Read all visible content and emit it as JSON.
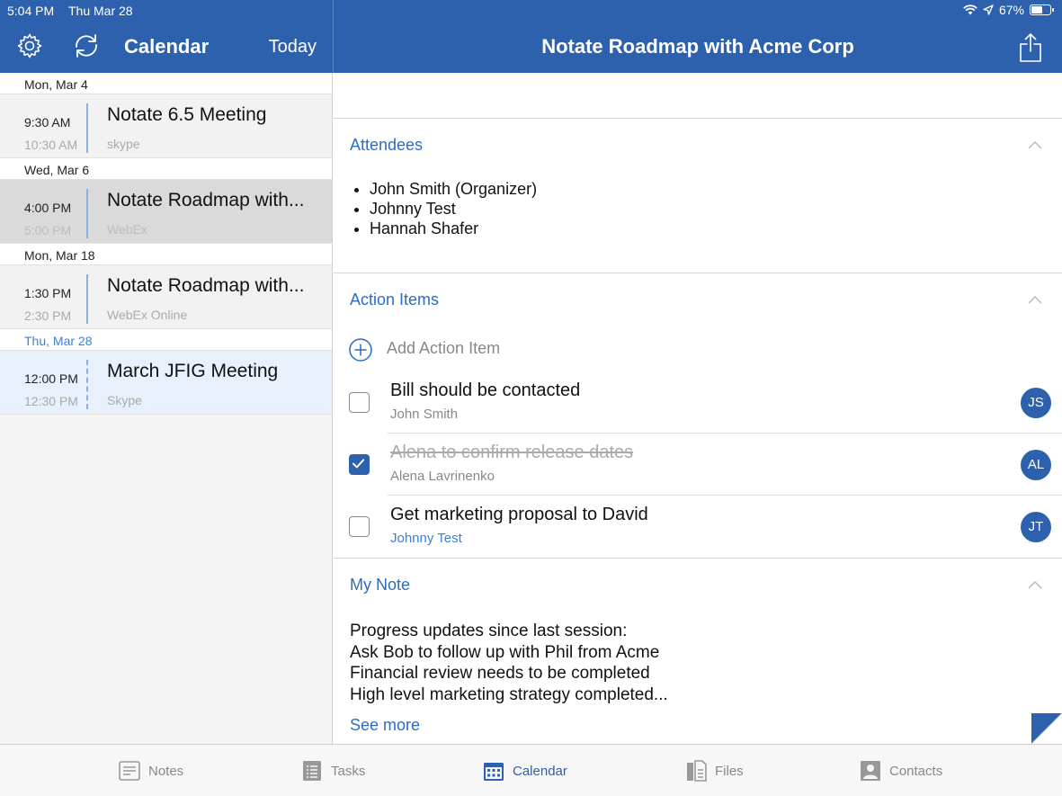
{
  "status_bar": {
    "time": "5:04 PM",
    "date": "Thu Mar 28",
    "battery": "67%",
    "battery_level": 0.67
  },
  "left_header": {
    "title": "Calendar",
    "today_label": "Today",
    "icons": [
      "gear-icon",
      "sync-icon"
    ]
  },
  "right_header": {
    "title": "Notate Roadmap with Acme Corp",
    "icons": [
      "share-icon"
    ]
  },
  "calendar": {
    "days": [
      {
        "label": "Mon, Mar 4",
        "event": {
          "start": "9:30 AM",
          "end": "10:30 AM",
          "title": "Notate 6.5 Meeting",
          "location": "skype"
        }
      },
      {
        "label": "Wed, Mar 6",
        "event": {
          "start": "4:00 PM",
          "end": "5:00 PM",
          "title": "Notate Roadmap with...",
          "location": "WebEx"
        }
      },
      {
        "label": "Mon, Mar 18",
        "event": {
          "start": "1:30 PM",
          "end": "2:30 PM",
          "title": "Notate Roadmap with...",
          "location": "WebEx Online"
        }
      },
      {
        "label": "Thu, Mar 28",
        "event": {
          "start": "12:00 PM",
          "end": "12:30 PM",
          "title": "March JFIG Meeting",
          "location": "Skype"
        }
      }
    ]
  },
  "attendees": {
    "title": "Attendees",
    "list": [
      "John Smith  (Organizer)",
      "Johnny Test",
      "Hannah Shafer"
    ]
  },
  "action_items": {
    "title": "Action Items",
    "add_label": "Add Action Item",
    "items": [
      {
        "text": "Bill should be contacted",
        "owner": "John Smith",
        "initials": "JS",
        "checked": false
      },
      {
        "text": "Alena to confirm release dates",
        "owner": "Alena Lavrinenko",
        "initials": "AL",
        "checked": true
      },
      {
        "text": "Get marketing proposal to David",
        "owner": "Johnny Test",
        "initials": "JT",
        "checked": false
      }
    ]
  },
  "my_note": {
    "title": "My Note",
    "lines": [
      "Progress updates since last session:",
      "Ask Bob to follow up with Phil from Acme",
      "Financial review needs to be completed",
      "High level marketing strategy completed..."
    ],
    "see_more": "See more"
  },
  "tabs": [
    {
      "label": "Notes",
      "icon": "notes-icon"
    },
    {
      "label": "Tasks",
      "icon": "tasks-icon"
    },
    {
      "label": "Calendar",
      "icon": "calendar-icon",
      "active": true
    },
    {
      "label": "Files",
      "icon": "files-icon"
    },
    {
      "label": "Contacts",
      "icon": "contacts-icon"
    }
  ],
  "colors": {
    "brand_blue": "#2d61ad",
    "link_blue": "#2d6cc0",
    "selected_row": "#dadada",
    "current_row": "#e7f0fb"
  }
}
